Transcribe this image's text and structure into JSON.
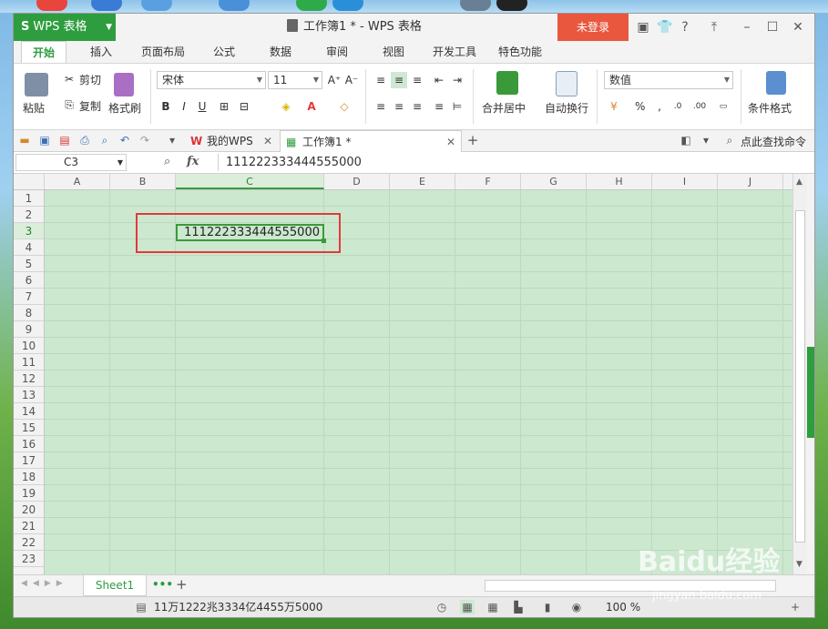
{
  "window": {
    "app_button": "WPS 表格",
    "title": "工作簿1 * - WPS 表格",
    "login": "未登录"
  },
  "tabs": [
    "开始",
    "插入",
    "页面布局",
    "公式",
    "数据",
    "审阅",
    "视图",
    "开发工具",
    "特色功能"
  ],
  "ribbon": {
    "paste": "粘贴",
    "cut": "剪切",
    "copy": "复制",
    "format_painter": "格式刷",
    "font_name": "宋体",
    "font_size": "11",
    "merge_center": "合并居中",
    "wrap_text": "自动换行",
    "number_format": "数值",
    "percent": "%",
    "conditional_format": "条件格式"
  },
  "doc_tabs": {
    "my_wps": "我的WPS",
    "workbook": "工作簿1 *",
    "search": "点此查找命令"
  },
  "formula_bar": {
    "name_box": "C3",
    "fx": "fx",
    "value": "111222333444555000"
  },
  "grid": {
    "columns": [
      "A",
      "B",
      "C",
      "D",
      "E",
      "F",
      "G",
      "H",
      "I",
      "J"
    ],
    "rows": [
      "1",
      "2",
      "3",
      "4",
      "5",
      "6",
      "7",
      "8",
      "9",
      "10",
      "11",
      "12",
      "13",
      "14",
      "15",
      "16",
      "17",
      "18",
      "19",
      "20",
      "21",
      "22",
      "23"
    ],
    "cell_c3": "111222333444555000"
  },
  "sheet": {
    "name": "Sheet1"
  },
  "status": {
    "text": "11万1222兆3334亿4455万5000",
    "zoom": "100 %"
  },
  "watermark": {
    "main": "Baidu经验",
    "sub": "jingyan.baidu.com"
  },
  "colors": {
    "accent": "#2e9d3f",
    "login": "#e8573e",
    "grid_bg": "#cce8cf",
    "highlight_box": "#e23a3a"
  }
}
